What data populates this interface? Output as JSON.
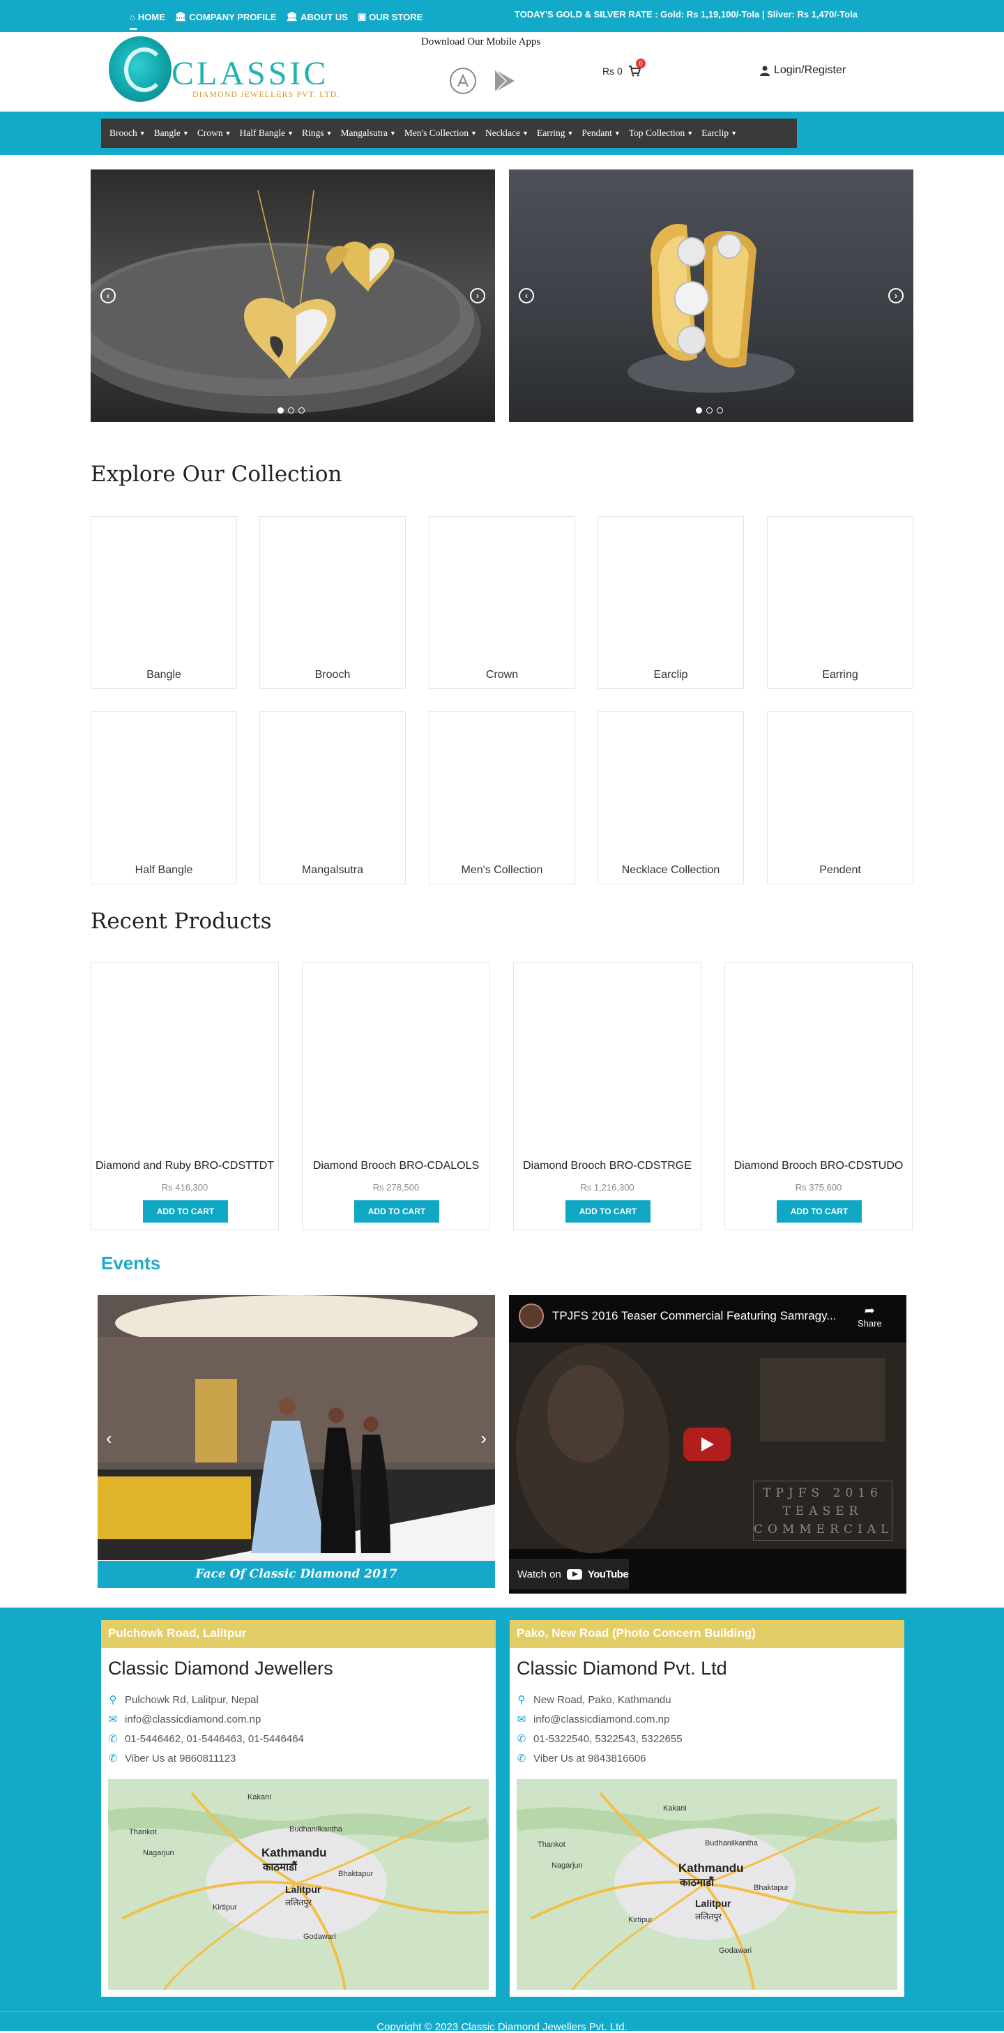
{
  "topbar": {
    "nav": [
      {
        "icon": "home-icon",
        "label": "HOME"
      },
      {
        "icon": "bank-icon",
        "label": "COMPANY PROFILE"
      },
      {
        "icon": "bank-icon",
        "label": "ABOUT US"
      },
      {
        "icon": "store-icon",
        "label": "OUR STORE"
      }
    ],
    "rate": "TODAY'S GOLD & SILVER RATE : Gold: Rs 1,19,100/-Tola | Sliver: Rs 1,470/-Tola"
  },
  "header": {
    "logo_word": "CLASSIC",
    "logo_sub": "DIAMOND JEWELLERS PVT. LTD.",
    "apps_title": "Download Our Mobile Apps",
    "cart_amount": "Rs 0",
    "cart_count": "0",
    "login_label": "Login/Register"
  },
  "menu": [
    "Brooch",
    "Bangle",
    "Crown",
    "Half Bangle",
    "Rings",
    "Mangalsutra",
    "Men's Collection",
    "Necklace",
    "Earring",
    "Pendant",
    "Top Collection",
    "Earclip"
  ],
  "explore": {
    "title": "Explore Our Collection",
    "items": [
      "Bangle",
      "Brooch",
      "Crown",
      "Earclip",
      "Earring",
      "Half Bangle",
      "Mangalsutra",
      "Men's Collection",
      "Necklace Collection",
      "Pendent"
    ]
  },
  "recent": {
    "title": "Recent Products",
    "button_label": "ADD TO CART",
    "products": [
      {
        "name": "Diamond and Ruby BRO-CDSTTDT",
        "price": "Rs 416,300"
      },
      {
        "name": "Diamond Brooch BRO-CDALOLS",
        "price": "Rs 278,500"
      },
      {
        "name": "Diamond Brooch BRO-CDSTRGE",
        "price": "Rs 1,216,300"
      },
      {
        "name": "Diamond Brooch BRO-CDSTUDO",
        "price": "Rs 375,600"
      }
    ]
  },
  "events": {
    "title": "Events",
    "caption": "Face Of Classic Diamond 2017",
    "video": {
      "title": "TPJFS 2016 Teaser Commercial Featuring Samragy...",
      "share": "Share",
      "watch_on": "Watch on",
      "youtube": "YouTube",
      "overlay_lines": [
        "TPJFS 2016",
        "TEASER",
        "COMMERCIAL"
      ]
    }
  },
  "footer": {
    "branches": [
      {
        "header": "Pulchowk Road, Lalitpur",
        "name": "Classic Diamond Jewellers",
        "address": "Pulchowk Rd, Lalitpur, Nepal",
        "email": "info@classicdiamond.com.np",
        "phone": "01-5446462, 01-5446463, 01-5446464",
        "viber": "Viber Us at 9860811123"
      },
      {
        "header": "Pako, New Road (Photo Concern Building)",
        "name": "Classic Diamond Pvt. Ltd",
        "address": "New Road, Pako, Kathmandu",
        "email": "info@classicdiamond.com.np",
        "phone": "01-5322540, 5322543, 5322655",
        "viber": "Viber Us at 9843816606"
      }
    ],
    "map_labels": [
      "Kathmandu",
      "काठमाडौं",
      "Lalitpur",
      "ललितपुर",
      "Bhaktapur",
      "Kirtipur",
      "Budhanilkantha",
      "Kakani",
      "Nagarjun",
      "Thankot",
      "Godawari"
    ],
    "copyright": "Copyright © 2023 Classic Diamond Jewellers Pvt. Ltd."
  },
  "colors": {
    "accent": "#13a9c9",
    "menu_bg": "#3a3a3a",
    "footer_header": "#e2cd67",
    "logo": "#22b2b6"
  }
}
